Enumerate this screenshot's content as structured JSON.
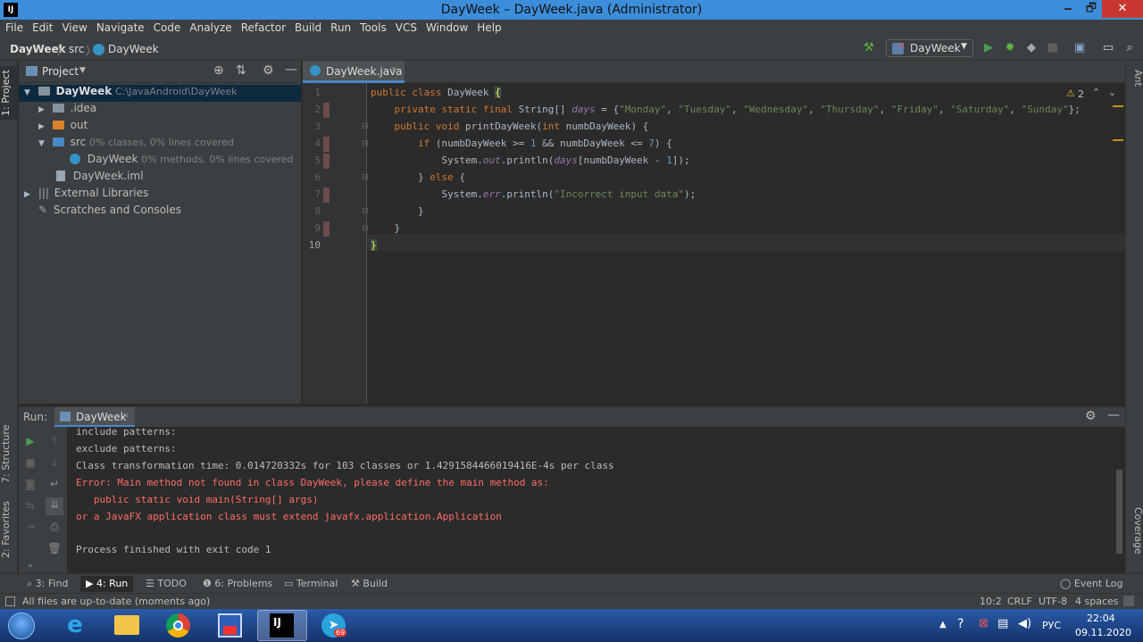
{
  "window": {
    "title": "DayWeek – DayWeek.java (Administrator)",
    "app_icon": "IJ",
    "minimize": "🗕",
    "restore": "🗗",
    "close": "✕"
  },
  "menu": [
    "File",
    "Edit",
    "View",
    "Navigate",
    "Code",
    "Analyze",
    "Refactor",
    "Build",
    "Run",
    "Tools",
    "VCS",
    "Window",
    "Help"
  ],
  "breadcrumb": {
    "project": "DayWeek",
    "sep": "〉",
    "src": "src",
    "file": "DayWeek"
  },
  "run_config": {
    "name": "DayWeek"
  },
  "side_tabs": {
    "project": "1: Project",
    "structure": "7: Structure",
    "favorites": "2: Favorites",
    "ant": "Ant",
    "coverage": "Coverage"
  },
  "project_panel": {
    "title": "Project",
    "tree": [
      {
        "label": "DayWeek",
        "hint": "C:\\JavaAndroid\\DayWeek"
      },
      {
        "label": ".idea",
        "hint": ""
      },
      {
        "label": "out",
        "hint": ""
      },
      {
        "label": "src",
        "hint": "0% classes, 0% lines covered"
      },
      {
        "label": "DayWeek",
        "hint": "0% methods, 0% lines covered"
      },
      {
        "label": "DayWeek.iml",
        "hint": ""
      },
      {
        "label": "External Libraries",
        "hint": ""
      },
      {
        "label": "Scratches and Consoles",
        "hint": ""
      }
    ]
  },
  "editor": {
    "tab": "DayWeek.java",
    "warnings": "2",
    "line_numbers": [
      "1",
      "2",
      "3",
      "4",
      "5",
      "6",
      "7",
      "8",
      "9",
      "10"
    ]
  },
  "run_panel": {
    "label": "Run:",
    "tab": "DayWeek",
    "output": [
      {
        "text": "include patterns:",
        "type": "normal"
      },
      {
        "text": "exclude patterns:",
        "type": "normal"
      },
      {
        "text": "Class transformation time: 0.014720332s for 103 classes or 1.4291584466019416E-4s per class",
        "type": "normal"
      },
      {
        "text": "Error: Main method not found in class DayWeek, please define the main method as:",
        "type": "error"
      },
      {
        "text": "   public static void main(String[] args)",
        "type": "error"
      },
      {
        "text": "or a JavaFX application class must extend javafx.application.Application",
        "type": "error"
      },
      {
        "text": "",
        "type": "normal"
      },
      {
        "text": "Process finished with exit code 1",
        "type": "normal"
      }
    ]
  },
  "tool_windows": {
    "find": "3: Find",
    "run": "4: Run",
    "todo": "TODO",
    "problems": "6: Problems",
    "terminal": "Terminal",
    "build": "Build",
    "event_log": "Event Log"
  },
  "status": {
    "message": "All files are up-to-date (moments ago)",
    "position": "10:2",
    "line_sep": "CRLF",
    "encoding": "UTF-8",
    "indent": "4 spaces"
  },
  "taskbar": {
    "lang": "РУС",
    "time": "22:04",
    "date": "09.11.2020",
    "telegram_badge": "69"
  },
  "colors": {
    "keyword": "#cc7832",
    "string": "#6a8759",
    "field": "#9876aa",
    "number": "#6897bb",
    "error": "#ff6b68",
    "accent": "#4a88c7"
  }
}
